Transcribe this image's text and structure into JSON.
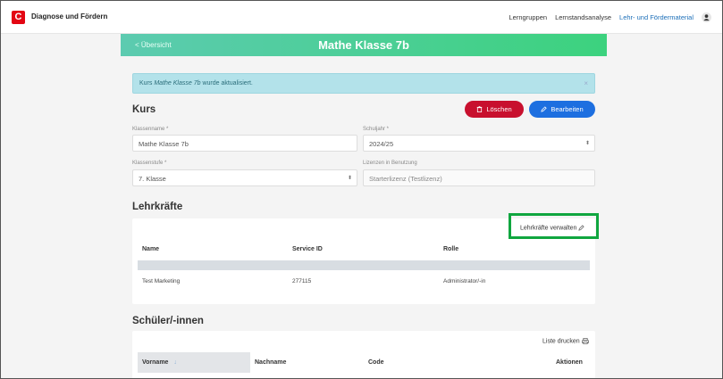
{
  "app": {
    "logo_letter": "C",
    "title": "Diagnose und Fördern",
    "nav": [
      "Lerngruppen",
      "Lernstandsanalyse",
      "Lehr- und Fördermaterial"
    ]
  },
  "header": {
    "back_label": "< Übersicht",
    "title": "Mathe Klasse 7b"
  },
  "alert": {
    "text_prefix": "Kurs ",
    "course_name": "Mathe Klasse 7b",
    "text_suffix": " wurde aktualisiert.",
    "close": "×"
  },
  "kurs": {
    "title": "Kurs",
    "delete_label": "Löschen",
    "edit_label": "Bearbeiten",
    "fields": {
      "klassenname_label": "Klassenname *",
      "klassenname_value": "Mathe Klasse 7b",
      "schuljahr_label": "Schuljahr *",
      "schuljahr_value": "2024/25",
      "klassenstufe_label": "Klassenstufe *",
      "klassenstufe_value": "7. Klasse",
      "lizenzen_label": "Lizenzen in Benutzung",
      "lizenzen_value": "Starterlizenz (Testlizenz)"
    }
  },
  "lehrkraefte": {
    "title": "Lehrkräfte",
    "manage_label": "Lehrkräfte verwalten",
    "columns": [
      "Name",
      "Service ID",
      "Rolle"
    ],
    "rows": [
      {
        "name": "Test Marketing",
        "service_id": "277115",
        "rolle": "Administrator/-in"
      }
    ]
  },
  "schueler": {
    "title": "Schüler/-innen",
    "print_label": "Liste drucken",
    "columns": [
      "Vorname",
      "Nachname",
      "Code",
      "Aktionen"
    ],
    "sort_indicator": "↓"
  },
  "colors": {
    "accent_red": "#c8102e",
    "accent_blue": "#1d6fe0",
    "header_green": "#3cd27e",
    "highlight_green": "#10a63f"
  }
}
